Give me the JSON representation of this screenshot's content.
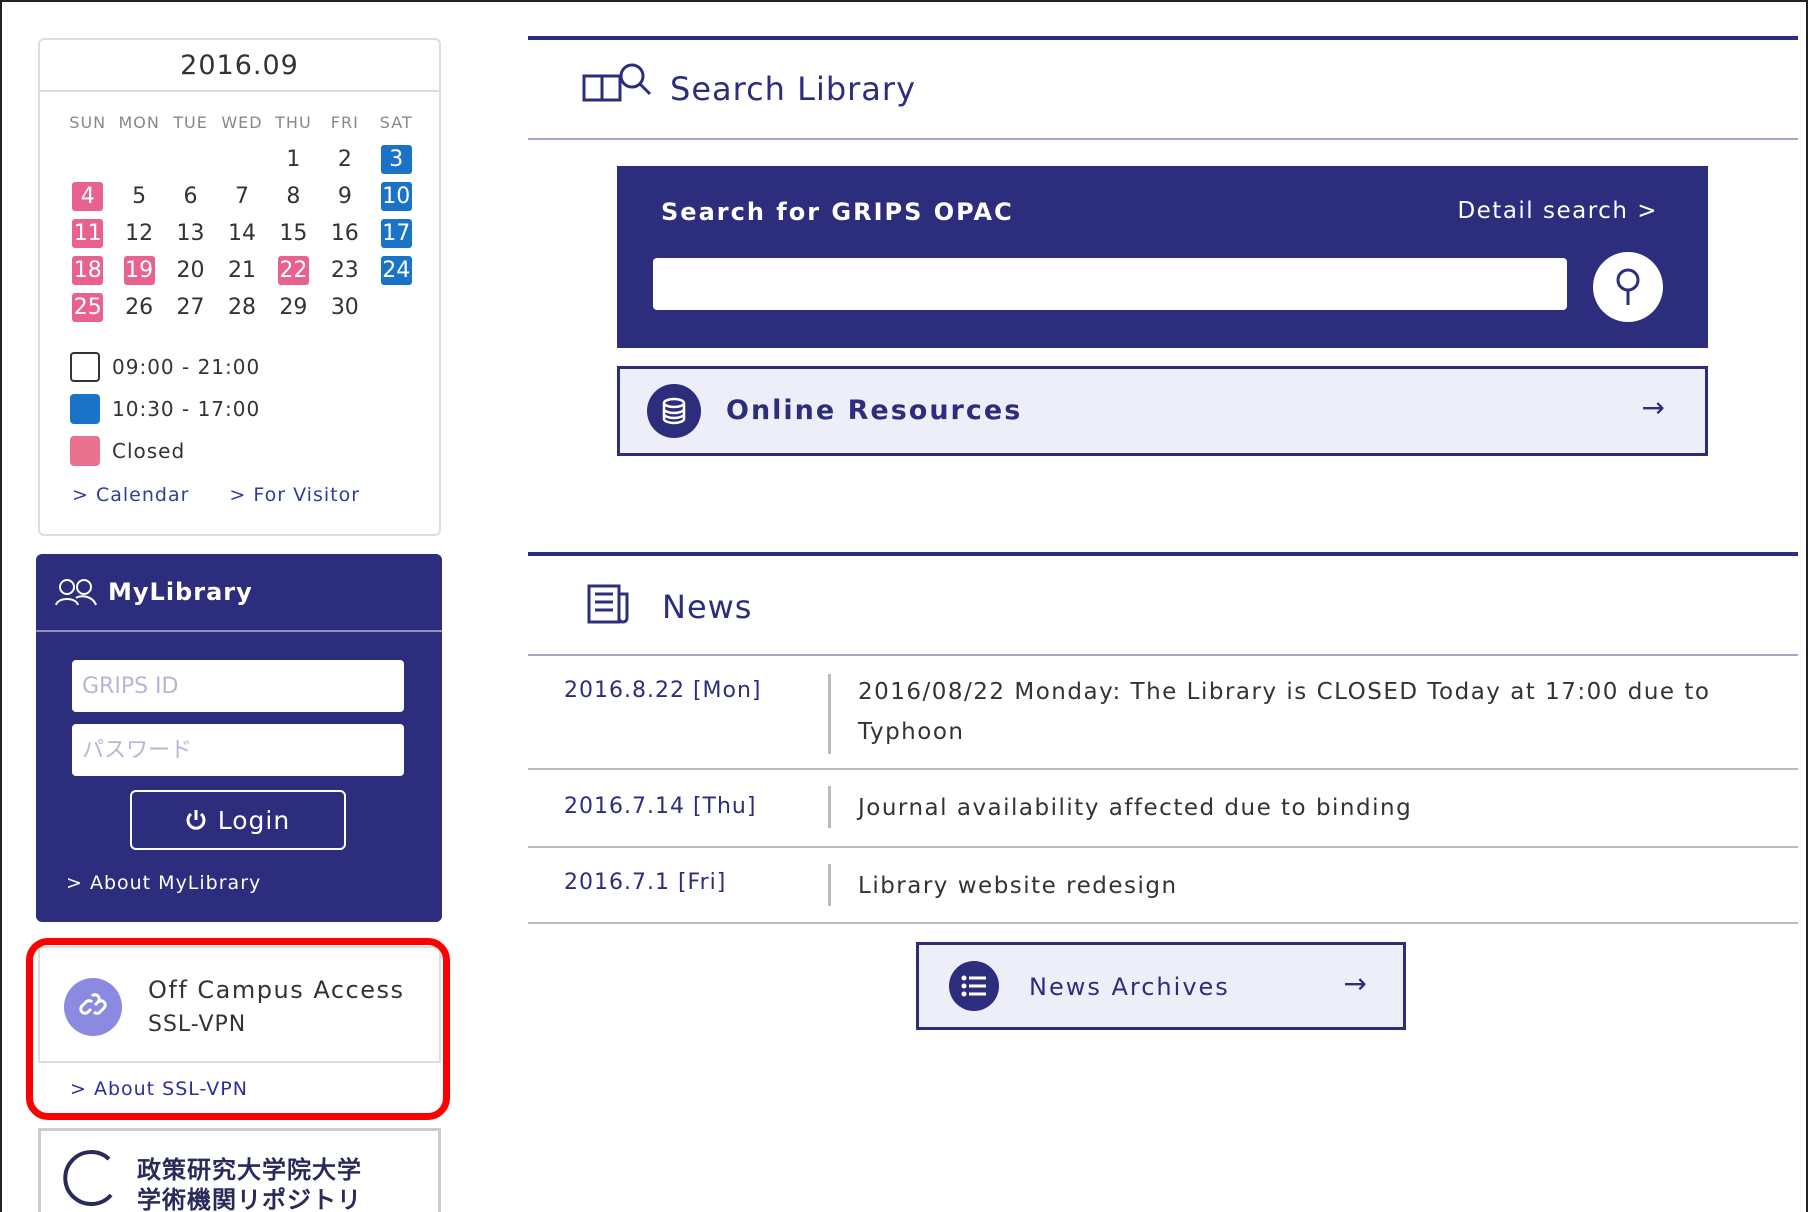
{
  "calendar": {
    "title": "2016.09",
    "weekdays": [
      "SUN",
      "MON",
      "TUE",
      "WED",
      "THU",
      "FRI",
      "SAT"
    ],
    "weeks": [
      [
        null,
        null,
        null,
        null,
        {
          "d": "1",
          "s": "open"
        },
        {
          "d": "2",
          "s": "open"
        },
        {
          "d": "3",
          "s": "short"
        }
      ],
      [
        {
          "d": "4",
          "s": "closed"
        },
        {
          "d": "5",
          "s": "open"
        },
        {
          "d": "6",
          "s": "open"
        },
        {
          "d": "7",
          "s": "open"
        },
        {
          "d": "8",
          "s": "open"
        },
        {
          "d": "9",
          "s": "open"
        },
        {
          "d": "10",
          "s": "short"
        }
      ],
      [
        {
          "d": "11",
          "s": "closed"
        },
        {
          "d": "12",
          "s": "open"
        },
        {
          "d": "13",
          "s": "open"
        },
        {
          "d": "14",
          "s": "open"
        },
        {
          "d": "15",
          "s": "open"
        },
        {
          "d": "16",
          "s": "open"
        },
        {
          "d": "17",
          "s": "short"
        }
      ],
      [
        {
          "d": "18",
          "s": "closed"
        },
        {
          "d": "19",
          "s": "closed"
        },
        {
          "d": "20",
          "s": "open"
        },
        {
          "d": "21",
          "s": "open"
        },
        {
          "d": "22",
          "s": "closed"
        },
        {
          "d": "23",
          "s": "open"
        },
        {
          "d": "24",
          "s": "short"
        }
      ],
      [
        {
          "d": "25",
          "s": "closed"
        },
        {
          "d": "26",
          "s": "open"
        },
        {
          "d": "27",
          "s": "open"
        },
        {
          "d": "28",
          "s": "open"
        },
        {
          "d": "29",
          "s": "open"
        },
        {
          "d": "30",
          "s": "open"
        },
        null
      ]
    ],
    "legend": {
      "open": "09:00 - 21:00",
      "short": "10:30 - 17:00",
      "closed": "Closed"
    },
    "links": {
      "calendar": "> Calendar",
      "visitor": "> For Visitor"
    },
    "colors": {
      "closed": "#e9628e",
      "short": "#1a73c6"
    }
  },
  "mylibrary": {
    "title": "MyLibrary",
    "id_placeholder": "GRIPS ID",
    "password_placeholder": "パスワード",
    "login_label": "Login",
    "about_link": "> About MyLibrary"
  },
  "offcampus": {
    "title": "Off Campus Access",
    "subtitle": "SSL-VPN",
    "about_link": "> About SSL-VPN"
  },
  "repository": {
    "line1": "政策研究大学院大学",
    "line2": "学術機関リポジトリ"
  },
  "search": {
    "section_title": "Search Library",
    "opac_label": "Search for GRIPS OPAC",
    "detail_link": "Detail search >",
    "online_resources": "Online Resources",
    "arrow": "→"
  },
  "news": {
    "section_title": "News",
    "items": [
      {
        "date": "2016.8.22 [Mon]",
        "text": "2016/08/22 Monday: The Library is CLOSED Today at 17:00 due to Typhoon"
      },
      {
        "date": "2016.7.14 [Thu]",
        "text": "Journal availability affected due to binding"
      },
      {
        "date": "2016.7.1 [Fri]",
        "text": "Library website redesign"
      }
    ],
    "archives_label": "News Archives",
    "arrow": "→"
  },
  "theme": {
    "primary": "#2d2d7d",
    "highlight": "#ff0000"
  }
}
